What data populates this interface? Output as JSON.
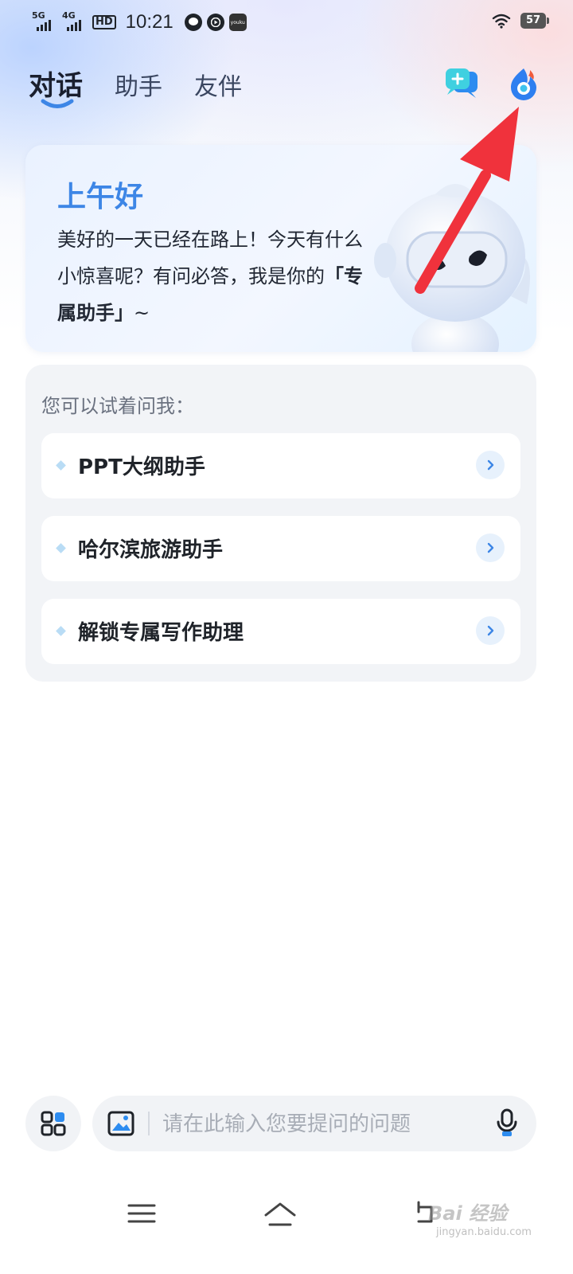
{
  "status_bar": {
    "signal_1": "5G",
    "signal_2": "4G",
    "hd": "HD",
    "time": "10:21",
    "battery": "57",
    "app_badge": "youku"
  },
  "tabs": [
    {
      "label": "对话",
      "active": true
    },
    {
      "label": "助手",
      "active": false
    },
    {
      "label": "友伴",
      "active": false
    }
  ],
  "header_actions": [
    "new-chat-icon",
    "app-logo-icon"
  ],
  "greeting": {
    "title": "上午好",
    "line1": "美好的一天已经在路上！今天有什么小惊喜呢？有问必答，我是你的",
    "highlight": "「专属助手」",
    "tail": "~"
  },
  "suggestions": {
    "heading": "您可以试着问我：",
    "items": [
      {
        "label": "PPT大纲助手"
      },
      {
        "label": "哈尔滨旅游助手"
      },
      {
        "label": "解锁专属写作助理"
      }
    ]
  },
  "input": {
    "placeholder": "请在此输入您要提问的问题",
    "value": ""
  },
  "watermark": {
    "main": "Bai 经验",
    "sub": "jingyan.baidu.com"
  },
  "colors": {
    "accent": "#3d86e6",
    "annotation_arrow": "#f0323c"
  }
}
